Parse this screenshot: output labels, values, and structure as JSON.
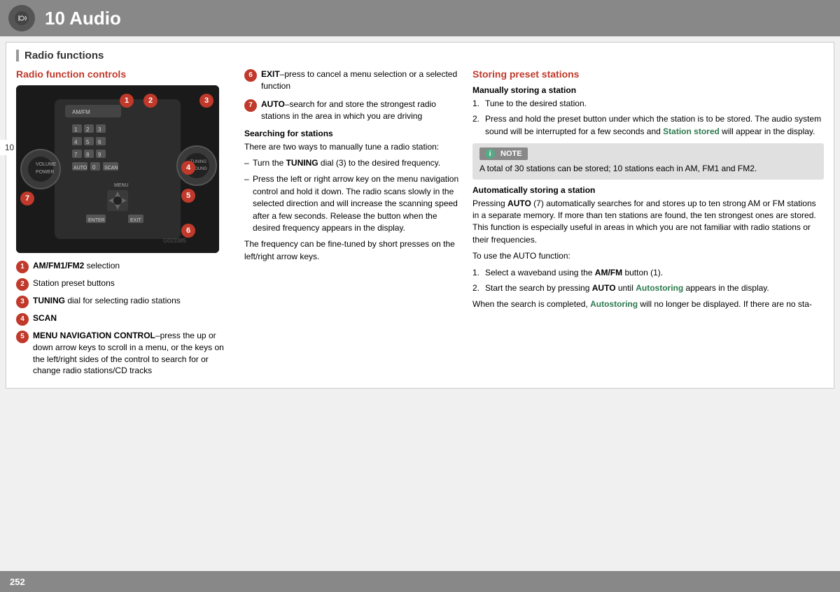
{
  "header": {
    "title": "10 Audio",
    "chapter": "10"
  },
  "section": {
    "title": "Radio functions"
  },
  "left_col": {
    "heading": "Radio function controls",
    "legend": [
      {
        "num": "1",
        "text": "AM/FM1/FM2 selection"
      },
      {
        "num": "2",
        "text": "Station preset buttons"
      },
      {
        "num": "3",
        "text": "TUNING dial for selecting radio stations"
      },
      {
        "num": "4",
        "text": "SCAN"
      },
      {
        "num": "5",
        "text": "MENU NAVIGATION CONTROL–press the up or down arrow keys to scroll in a menu, or the keys on the left/right sides of the control to search for or change radio stations/CD tracks"
      }
    ]
  },
  "mid_col": {
    "steps": [
      {
        "num": "6",
        "label": "EXIT",
        "text": "–press to cancel a menu selection or a selected function"
      },
      {
        "num": "7",
        "label": "AUTO",
        "text": "–search for and store the strongest radio stations in the area in which you are driving"
      }
    ],
    "searching": {
      "heading": "Searching for stations",
      "intro": "There are two ways to manually tune a radio station:",
      "bullets": [
        "Turn the TUNING dial (3) to the desired frequency.",
        "Press the left or right arrow key on the menu navigation control and hold it down. The radio scans slowly in the selected direction and will increase the scanning speed after a few seconds. Release the button when the desired frequency appears in the display."
      ],
      "fine_tune": "The frequency can be fine-tuned by short presses on the left/right arrow keys."
    }
  },
  "right_col": {
    "heading": "Storing preset stations",
    "manually": {
      "heading": "Manually storing a station",
      "steps": [
        "Tune to the desired station.",
        "Press and hold the preset button under which the station is to be stored. The audio system sound will be interrupted for a few seconds and Station stored will appear in the display."
      ]
    },
    "note": {
      "label": "NOTE",
      "text": "A total of 30 stations can be stored; 10 stations each in AM, FM1 and FM2."
    },
    "automatically": {
      "heading": "Automatically storing a station",
      "intro": "Pressing AUTO (7) automatically searches for and stores up to ten strong AM or FM stations in a separate memory. If more than ten stations are found, the ten strongest ones are stored. This function is especially useful in areas in which you are not familiar with radio stations or their frequencies.",
      "use_intro": "To use the AUTO function:",
      "steps": [
        "Select a waveband using the AM/FM button (1).",
        "Start the search by pressing AUTO until Autostoring appears in the display."
      ],
      "footer_text": "When the search is completed, Autostoring will no longer be displayed. If there are no sta-"
    }
  },
  "footer": {
    "page": "252"
  }
}
